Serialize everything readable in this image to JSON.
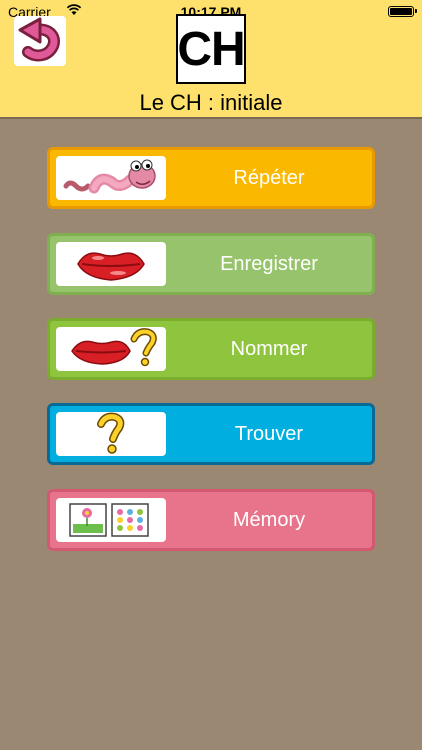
{
  "status_bar": {
    "carrier": "Carrier",
    "time": "10:17 PM"
  },
  "header": {
    "letter": "CH",
    "subtitle": "Le CH : initiale"
  },
  "menu": [
    {
      "label": "Répéter",
      "icon": "worm-icon",
      "color": "#fbb800"
    },
    {
      "label": "Enregistrer",
      "icon": "lips-icon",
      "color": "#96c36b"
    },
    {
      "label": "Nommer",
      "icon": "lips-question-icon",
      "color": "#8fc53e"
    },
    {
      "label": "Trouver",
      "icon": "question-mark-icon",
      "color": "#00afe0"
    },
    {
      "label": "Mémory",
      "icon": "memory-cards-icon",
      "color": "#e7748a"
    }
  ]
}
